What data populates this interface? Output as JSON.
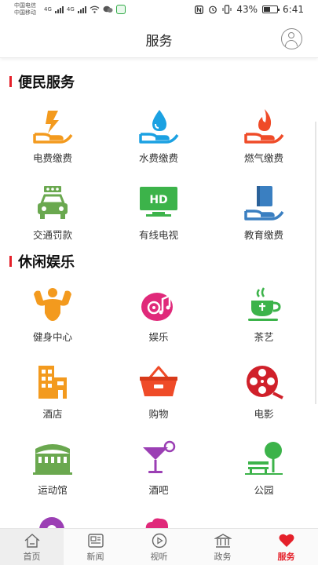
{
  "status_bar": {
    "carrier1": "中国电信",
    "carrier2": "中国移动",
    "net1": "4G",
    "net2": "4G",
    "battery": "43%",
    "time": "6:41"
  },
  "header": {
    "title": "服务"
  },
  "sections": [
    {
      "title": "便民服务",
      "items": [
        {
          "label": "电费缴费",
          "icon": "electricity-bill-icon"
        },
        {
          "label": "水费缴费",
          "icon": "water-bill-icon"
        },
        {
          "label": "燃气缴费",
          "icon": "gas-bill-icon"
        },
        {
          "label": "交通罚款",
          "icon": "traffic-fine-icon"
        },
        {
          "label": "有线电视",
          "icon": "cable-tv-icon",
          "icon_text": "HD"
        },
        {
          "label": "教育缴费",
          "icon": "education-fee-icon"
        }
      ]
    },
    {
      "title": "休闲娱乐",
      "items": [
        {
          "label": "健身中心",
          "icon": "fitness-icon"
        },
        {
          "label": "娱乐",
          "icon": "entertainment-icon"
        },
        {
          "label": "茶艺",
          "icon": "tea-icon"
        },
        {
          "label": "酒店",
          "icon": "hotel-icon"
        },
        {
          "label": "购物",
          "icon": "shopping-basket-icon"
        },
        {
          "label": "电影",
          "icon": "film-reel-icon"
        },
        {
          "label": "运动馆",
          "icon": "stadium-icon"
        },
        {
          "label": "酒吧",
          "icon": "cocktail-icon"
        },
        {
          "label": "公园",
          "icon": "park-icon"
        }
      ]
    }
  ],
  "tabbar": [
    {
      "label": "首页",
      "icon": "home-icon"
    },
    {
      "label": "新闻",
      "icon": "news-icon"
    },
    {
      "label": "视听",
      "icon": "play-icon"
    },
    {
      "label": "政务",
      "icon": "government-icon"
    },
    {
      "label": "服务",
      "icon": "heart-icon",
      "active": true
    }
  ],
  "colors": {
    "accent": "#e5202a",
    "orange": "#f39a1e",
    "blue": "#1ba1e2",
    "green": "#4caf50"
  }
}
